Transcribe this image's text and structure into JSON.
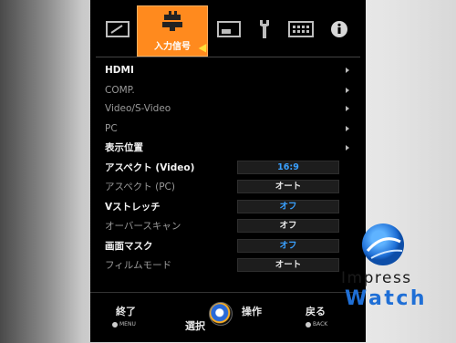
{
  "tabs": [
    {
      "icon": "picture-icon"
    },
    {
      "label": "入力信号",
      "icon": "input-connector-icon",
      "active": true
    },
    {
      "icon": "screen-icon"
    },
    {
      "icon": "wrench-icon"
    },
    {
      "icon": "keypad-icon"
    },
    {
      "icon": "info-icon"
    }
  ],
  "menu": [
    {
      "label": "HDMI",
      "enabled": true,
      "submenu": true
    },
    {
      "label": "COMP.",
      "enabled": false,
      "submenu": true
    },
    {
      "label": "Video/S-Video",
      "enabled": false,
      "submenu": true
    },
    {
      "label": "PC",
      "enabled": false,
      "submenu": true
    },
    {
      "label": "表示位置",
      "enabled": true,
      "submenu": true
    },
    {
      "label": "アスペクト (Video)",
      "enabled": true,
      "value": "16:9"
    },
    {
      "label": "アスペクト (PC)",
      "enabled": false,
      "value": "オート"
    },
    {
      "label": "Vストレッチ",
      "enabled": true,
      "value": "オフ"
    },
    {
      "label": "オーバースキャン",
      "enabled": false,
      "value": "オフ"
    },
    {
      "label": "画面マスク",
      "enabled": true,
      "value": "オフ"
    },
    {
      "label": "フィルムモード",
      "enabled": false,
      "value": "オート"
    }
  ],
  "footer": {
    "exit_label": "終了",
    "exit_sub": "MENU",
    "select_label": "選択",
    "operate_label": "操作",
    "back_label": "戻る",
    "back_sub": "BACK"
  },
  "watermark": {
    "line1": "Impress",
    "line2": "Watch"
  },
  "colors": {
    "accent": "#ff8a1e",
    "value_enabled": "#3aa0ff",
    "value_disabled": "#e6e6e6"
  }
}
